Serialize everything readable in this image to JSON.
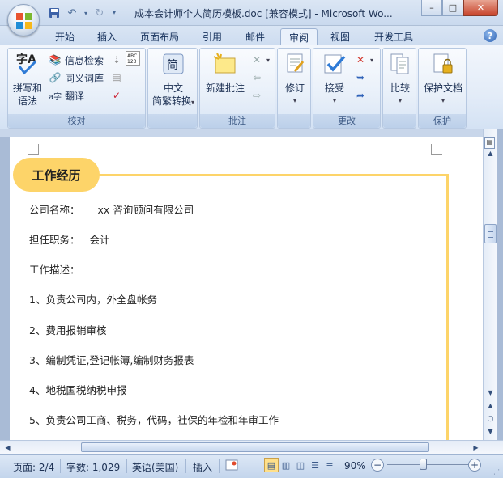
{
  "window": {
    "title": "成本会计师个人简历模板.doc [兼容模式] - Microsoft Wo...",
    "controls": {
      "minimize": "–",
      "maximize": "□",
      "close": "✕"
    }
  },
  "tabs": [
    "开始",
    "插入",
    "页面布局",
    "引用",
    "邮件",
    "审阅",
    "视图",
    "开发工具"
  ],
  "active_tab": "审阅",
  "ribbon": {
    "proofing": {
      "label": "校对",
      "spelling_line1": "拼写和",
      "spelling_line2": "语法",
      "research": "信息检索",
      "thesaurus": "同义词库",
      "translate": "翻译",
      "abc_badge": "ABC\n123"
    },
    "chinese": {
      "label": "",
      "line1": "中文",
      "line2": "简繁转换"
    },
    "comments": {
      "label": "批注",
      "new_comment": "新建批注"
    },
    "tracking": {
      "label": "",
      "line1": "修订"
    },
    "changes": {
      "label": "更改",
      "accept": "接受"
    },
    "compare": {
      "label": "",
      "line1": "比较"
    },
    "protect": {
      "label": "保护",
      "line1": "保护文档"
    }
  },
  "document": {
    "section_title": "工作经历",
    "company_label": "公司名称：",
    "company_value": "xx 咨询顾问有限公司",
    "position_label": "担任职务：",
    "position_value": "会计",
    "desc_label": "工作描述：",
    "items": [
      "1、负责公司内，外全盘帐务",
      "2、费用报销审核",
      "3、编制凭证,登记帐簿,编制财务报表",
      "4、地税国税纳税申报",
      "5、负责公司工商、税务，代码，社保的年检和年审工作"
    ]
  },
  "status": {
    "page": "页面: 2/4",
    "words": "字数: 1,029",
    "language": "英语(美国)",
    "mode": "插入",
    "zoom": "90%",
    "zoom_percent": 90
  },
  "colors": {
    "section_accent": "#fdd469",
    "ribbon_text": "#1b2f52"
  }
}
